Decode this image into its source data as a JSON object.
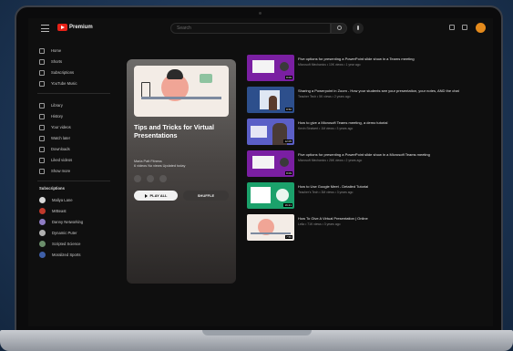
{
  "app": {
    "logo_text": "Premium",
    "search_placeholder": "Search"
  },
  "sidebar": {
    "items": [
      {
        "label": "Home",
        "icon": "home-icon"
      },
      {
        "label": "Shorts",
        "icon": "shorts-icon"
      },
      {
        "label": "Subscriptions",
        "icon": "subscriptions-icon"
      },
      {
        "label": "YouTube Music",
        "icon": "music-icon"
      },
      {
        "label": "Library",
        "icon": "library-icon"
      },
      {
        "label": "History",
        "icon": "history-icon"
      },
      {
        "label": "Your videos",
        "icon": "video-icon"
      },
      {
        "label": "Watch later",
        "icon": "clock-icon"
      },
      {
        "label": "Downloads",
        "icon": "download-icon"
      },
      {
        "label": "Liked videos",
        "icon": "like-icon"
      },
      {
        "label": "Show more",
        "icon": "chevron-down-icon"
      }
    ],
    "subscriptions_heading": "Subscriptions",
    "subscriptions": [
      {
        "label": "Maliya Lane",
        "color": "#d8d8d8"
      },
      {
        "label": "MrBeast",
        "color": "#c0392b"
      },
      {
        "label": "Danny Networking",
        "color": "#8e7cc3"
      },
      {
        "label": "Dynamic Puter",
        "color": "#b0b0b0"
      },
      {
        "label": "Scripted Science",
        "color": "#6b8e6b"
      },
      {
        "label": "Moralized Sports",
        "color": "#3e5fa8"
      }
    ]
  },
  "playlist": {
    "title": "Tips and Tricks for Virtual Presentations",
    "meta": "Maria Patt Fitness",
    "meta2": "6 videos  No views  Updated today",
    "play_all_label": "PLAY ALL",
    "shuffle_label": "SHUFFLE"
  },
  "videos": [
    {
      "title": "Five options for presenting a PowerPoint slide show in a Teams meeting",
      "meta": "Microsoft Mechanics • 10K views • 1 year ago",
      "duration": "8:09",
      "thumb": "ppt"
    },
    {
      "title": "Sharing a Powerpoint in Zoom - How your students see your presentation, your notes, AND the chat",
      "meta": "Teacher Tech • 5K views • 2 years ago",
      "duration": "8:50",
      "thumb": "blue"
    },
    {
      "title": "How to give a Microsoft Teams meeting, a demo tutorial",
      "meta": "Kevin Stratvert • 1M views • 3 years ago",
      "duration": "12:05",
      "thumb": "teams"
    },
    {
      "title": "Five options for presenting a PowerPoint slide show in a Microsoft Teams meeting",
      "meta": "Microsoft Mechanics • 26K views • 2 years ago",
      "duration": "8:09",
      "thumb": "ppt"
    },
    {
      "title": "How to Use Google Meet - Detailed Tutorial",
      "meta": "Teacher's Tech • 3M views • 3 years ago",
      "duration": "16:21",
      "thumb": "meet"
    },
    {
      "title": "How To Give A Virtual Presentation | Online",
      "meta": "Leila • 71K views • 3 years ago",
      "duration": "7:55",
      "thumb": "tips"
    }
  ]
}
